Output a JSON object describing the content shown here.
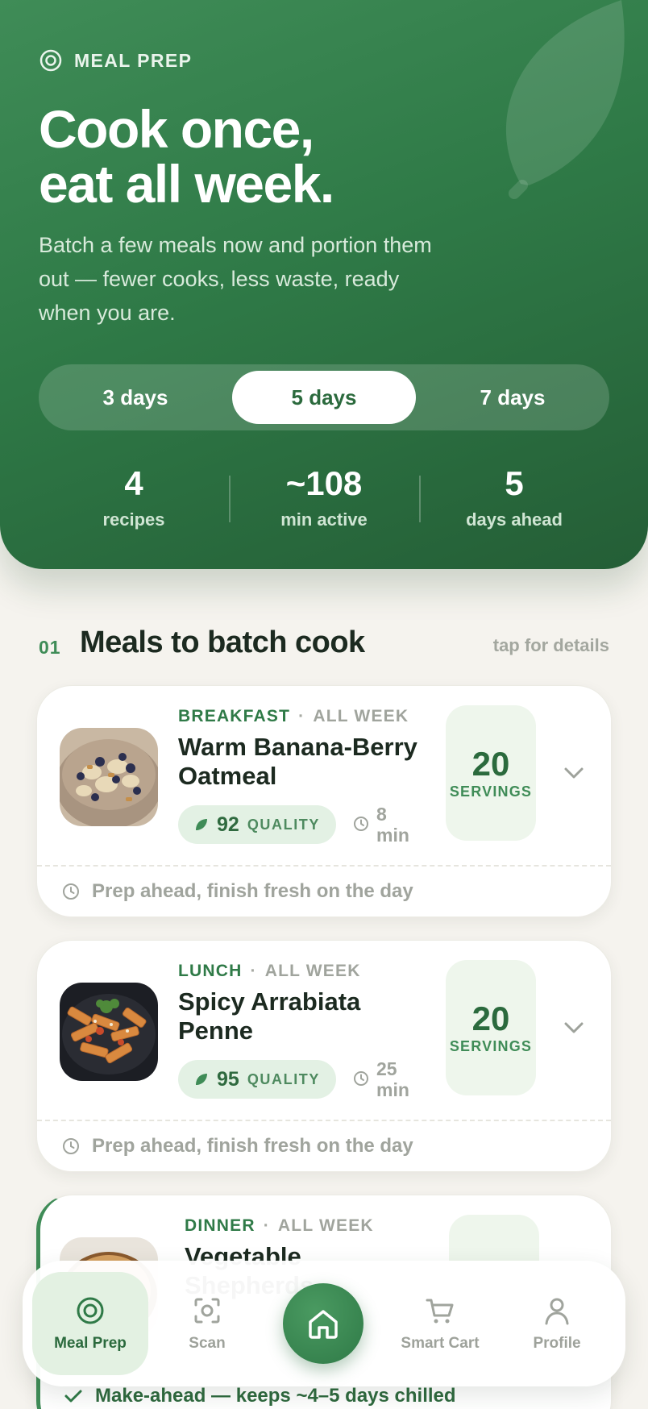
{
  "brand": {
    "label": "MEAL PREP",
    "icon": "target-icon"
  },
  "hero": {
    "title_line1": "Cook once,",
    "title_line2": "eat all week.",
    "subtitle": "Batch a few meals now and portion them out — fewer cooks, less waste, ready when you are."
  },
  "duration_tabs": [
    {
      "label": "3 days",
      "active": false
    },
    {
      "label": "5 days",
      "active": true
    },
    {
      "label": "7 days",
      "active": false
    }
  ],
  "stats": [
    {
      "value": "4",
      "label": "recipes"
    },
    {
      "value": "~108",
      "label": "min active"
    },
    {
      "value": "5",
      "label": "days ahead"
    }
  ],
  "section": {
    "number": "01",
    "title": "Meals to batch cook",
    "hint": "tap for details"
  },
  "meals": [
    {
      "type": "BREAKFAST",
      "when": "ALL WEEK",
      "name": "Warm Banana-Berry Oatmeal",
      "quality": "92",
      "quality_label": "QUALITY",
      "time": "8 min",
      "servings": "20",
      "servings_label": "SERVINGS",
      "note": "Prep ahead, finish fresh on the day"
    },
    {
      "type": "LUNCH",
      "when": "ALL WEEK",
      "name": "Spicy Arrabiata Penne",
      "quality": "95",
      "quality_label": "QUALITY",
      "time": "25 min",
      "servings": "20",
      "servings_label": "SERVINGS",
      "note": "Prep ahead, finish fresh on the day"
    },
    {
      "type": "DINNER",
      "when": "ALL WEEK",
      "name": "Vegetable Shepherds",
      "note": "Make-ahead — keeps ~4–5 days chilled"
    }
  ],
  "nav": {
    "items": [
      {
        "label": "Meal Prep",
        "icon": "target-icon",
        "active": true
      },
      {
        "label": "Scan",
        "icon": "scan-icon",
        "active": false
      },
      {
        "label": "Home",
        "icon": "home-icon",
        "active": false
      },
      {
        "label": "Smart Cart",
        "icon": "cart-icon",
        "active": false
      },
      {
        "label": "Profile",
        "icon": "user-icon",
        "active": false
      }
    ]
  },
  "colors": {
    "primary": "#2f7a47",
    "primary_light": "#e3f1e4",
    "background": "#f5f3ee"
  }
}
